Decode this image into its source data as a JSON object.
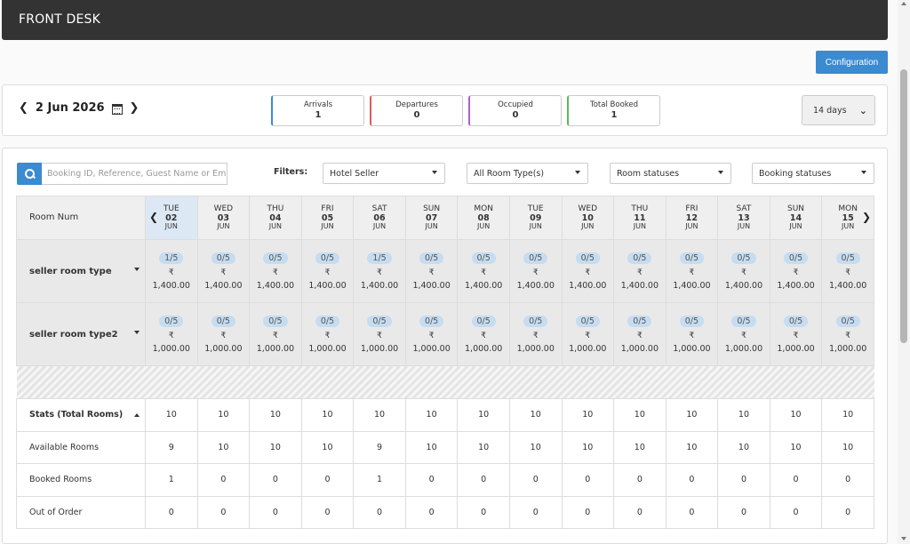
{
  "app": {
    "title": "FRONT DESK"
  },
  "toolbar": {
    "configuration_label": "Configuration"
  },
  "date_nav": {
    "current_date": "2 Jun 2026"
  },
  "stats": {
    "arrivals": {
      "label": "Arrivals",
      "value": "1"
    },
    "departures": {
      "label": "Departures",
      "value": "0"
    },
    "occupied": {
      "label": "Occupied",
      "value": "0"
    },
    "total_booked": {
      "label": "Total Booked",
      "value": "1"
    }
  },
  "range_select": {
    "value": "14 days"
  },
  "search": {
    "placeholder": "Booking ID, Reference, Guest Name or Email"
  },
  "filters": {
    "label": "Filters:",
    "hotel": "Hotel Seller",
    "room_type": "All Room Type(s)",
    "room_status": "Room statuses",
    "booking_status": "Booking statuses"
  },
  "grid": {
    "room_num_header": "Room Num",
    "days": [
      {
        "dow": "TUE",
        "day": "02",
        "mon": "JUN"
      },
      {
        "dow": "WED",
        "day": "03",
        "mon": "JUN"
      },
      {
        "dow": "THU",
        "day": "04",
        "mon": "JUN"
      },
      {
        "dow": "FRI",
        "day": "05",
        "mon": "JUN"
      },
      {
        "dow": "SAT",
        "day": "06",
        "mon": "JUN"
      },
      {
        "dow": "SUN",
        "day": "07",
        "mon": "JUN"
      },
      {
        "dow": "MON",
        "day": "08",
        "mon": "JUN"
      },
      {
        "dow": "TUE",
        "day": "09",
        "mon": "JUN"
      },
      {
        "dow": "WED",
        "day": "10",
        "mon": "JUN"
      },
      {
        "dow": "THU",
        "day": "11",
        "mon": "JUN"
      },
      {
        "dow": "FRI",
        "day": "12",
        "mon": "JUN"
      },
      {
        "dow": "SAT",
        "day": "13",
        "mon": "JUN"
      },
      {
        "dow": "SUN",
        "day": "14",
        "mon": "JUN"
      },
      {
        "dow": "MON",
        "day": "15",
        "mon": "JUN"
      }
    ],
    "currency": "₹",
    "room_types": [
      {
        "name": "seller room type",
        "avail": [
          "1/5",
          "0/5",
          "0/5",
          "0/5",
          "1/5",
          "0/5",
          "0/5",
          "0/5",
          "0/5",
          "0/5",
          "0/5",
          "0/5",
          "0/5",
          "0/5"
        ],
        "prices": [
          "1,400.00",
          "1,400.00",
          "1,400.00",
          "1,400.00",
          "1,400.00",
          "1,400.00",
          "1,400.00",
          "1,400.00",
          "1,400.00",
          "1,400.00",
          "1,400.00",
          "1,400.00",
          "1,400.00",
          "1,400.00"
        ]
      },
      {
        "name": "seller room type2",
        "avail": [
          "0/5",
          "0/5",
          "0/5",
          "0/5",
          "0/5",
          "0/5",
          "0/5",
          "0/5",
          "0/5",
          "0/5",
          "0/5",
          "0/5",
          "0/5",
          "0/5"
        ],
        "prices": [
          "1,000.00",
          "1,000.00",
          "1,000.00",
          "1,000.00",
          "1,000.00",
          "1,000.00",
          "1,000.00",
          "1,000.00",
          "1,000.00",
          "1,000.00",
          "1,000.00",
          "1,000.00",
          "1,000.00",
          "1,000.00"
        ]
      }
    ],
    "stats_rows": [
      {
        "label": "Stats (Total Rooms)",
        "values": [
          "10",
          "10",
          "10",
          "10",
          "10",
          "10",
          "10",
          "10",
          "10",
          "10",
          "10",
          "10",
          "10",
          "10"
        ]
      },
      {
        "label": "Available Rooms",
        "values": [
          "9",
          "10",
          "10",
          "10",
          "9",
          "10",
          "10",
          "10",
          "10",
          "10",
          "10",
          "10",
          "10",
          "10"
        ]
      },
      {
        "label": "Booked Rooms",
        "values": [
          "1",
          "0",
          "0",
          "0",
          "1",
          "0",
          "0",
          "0",
          "0",
          "0",
          "0",
          "0",
          "0",
          "0"
        ]
      },
      {
        "label": "Out of Order",
        "values": [
          "0",
          "0",
          "0",
          "0",
          "0",
          "0",
          "0",
          "0",
          "0",
          "0",
          "0",
          "0",
          "0",
          "0"
        ]
      }
    ]
  },
  "colors": {
    "accent": "#3a8bd1",
    "topbar": "#333333",
    "today_highlight": "#dde8f5"
  }
}
